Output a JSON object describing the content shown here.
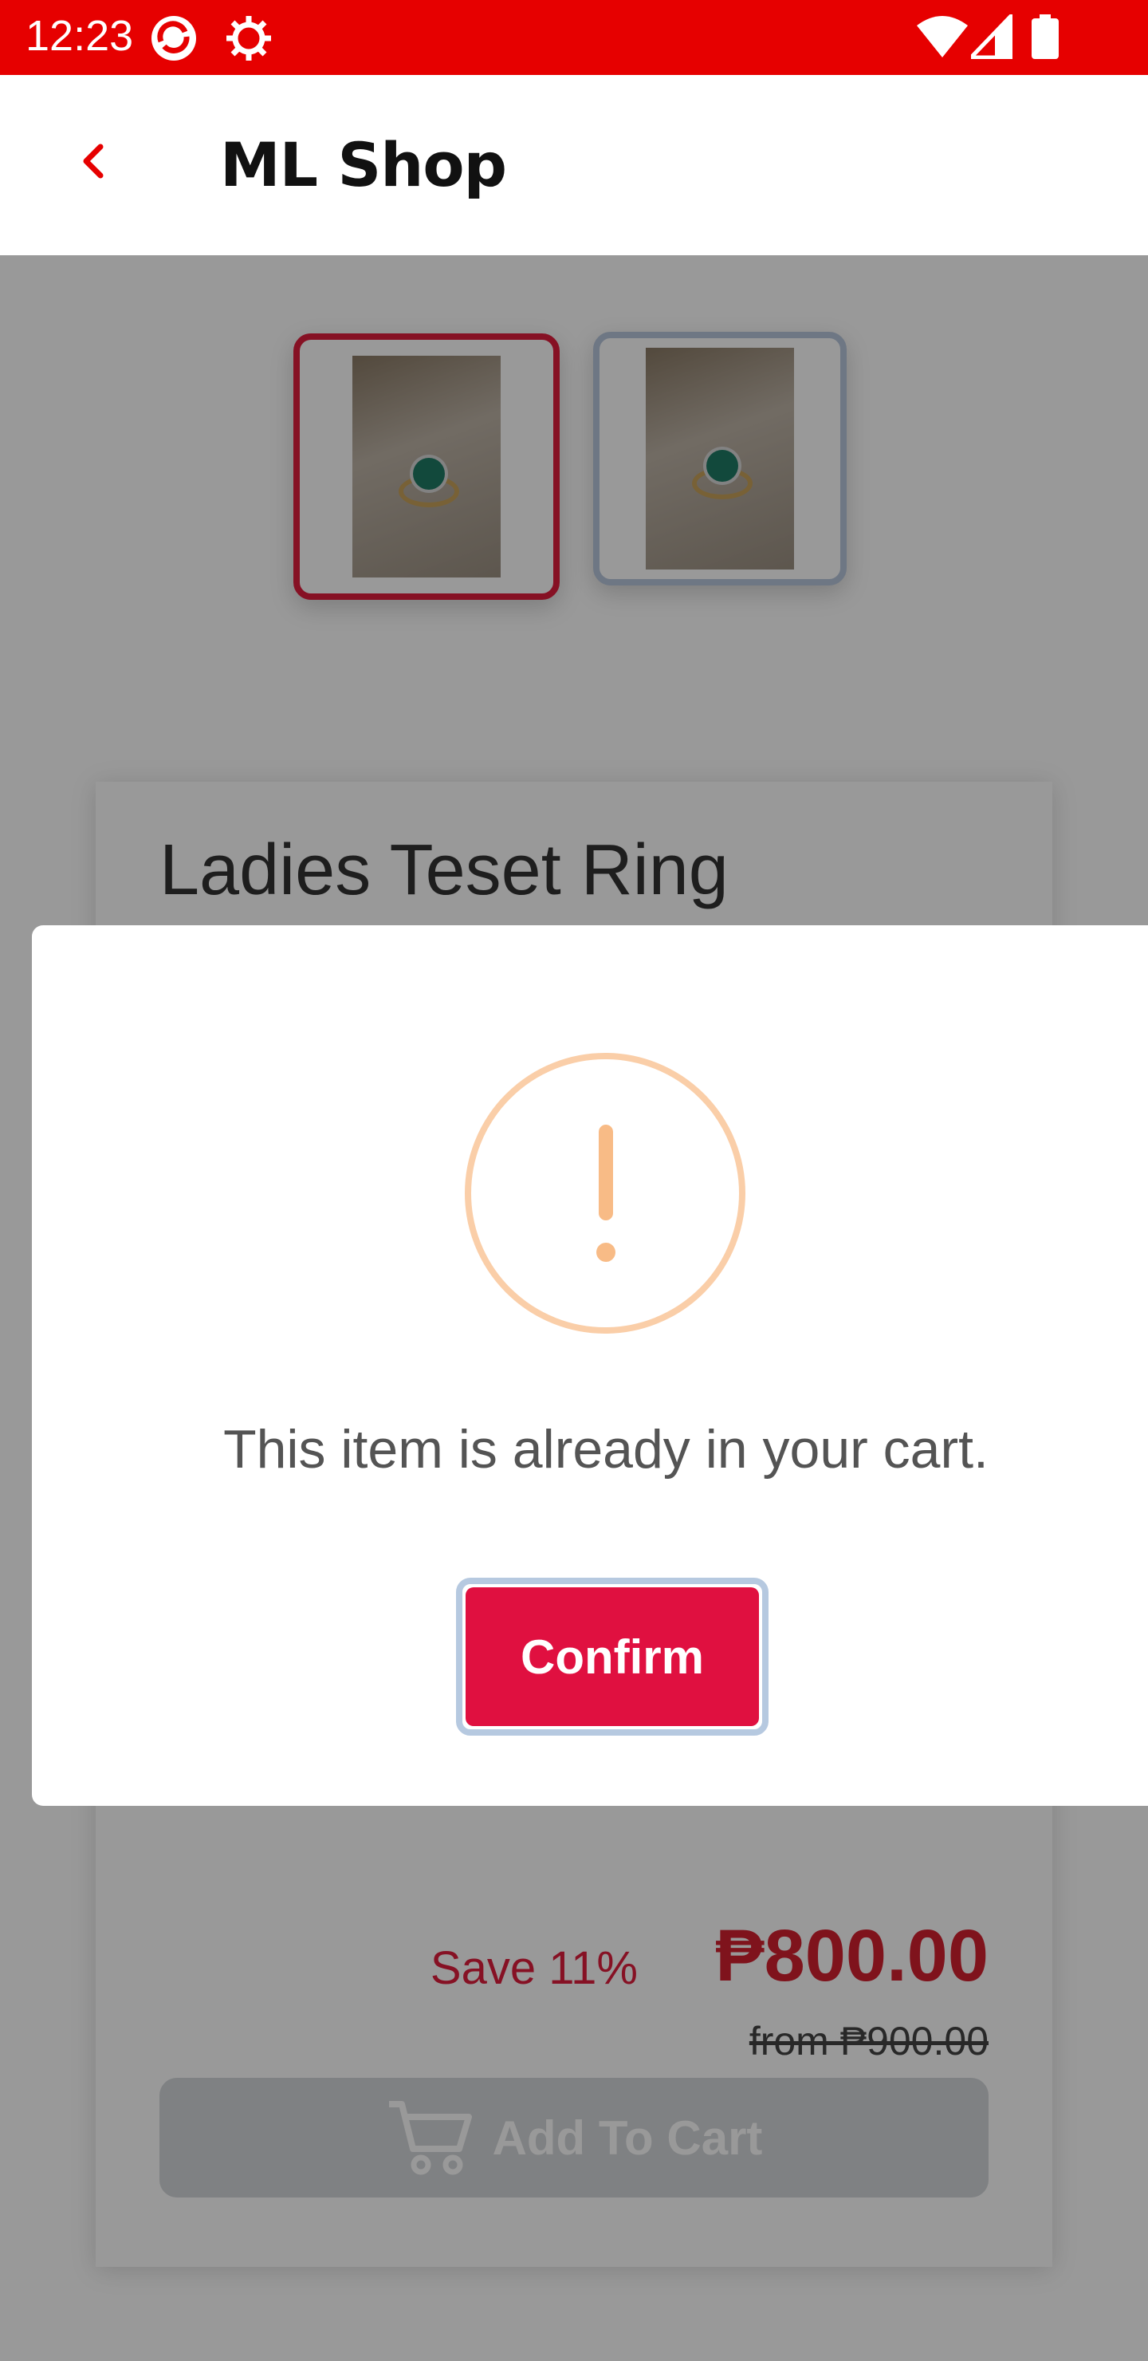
{
  "status_bar": {
    "time": "12:23"
  },
  "app_bar": {
    "title": "ML Shop"
  },
  "product": {
    "name": "Ladies Teset Ring",
    "save_label": "Save 11%",
    "price": "₱800.00",
    "original_price": "from ₱900.00",
    "add_to_cart_label": "Add To Cart"
  },
  "dialog": {
    "message": "This item is already in your cart.",
    "confirm_label": "Confirm"
  },
  "colors": {
    "status_bar": "#e60000",
    "accent": "#e01040",
    "warning": "#f8bb86"
  }
}
